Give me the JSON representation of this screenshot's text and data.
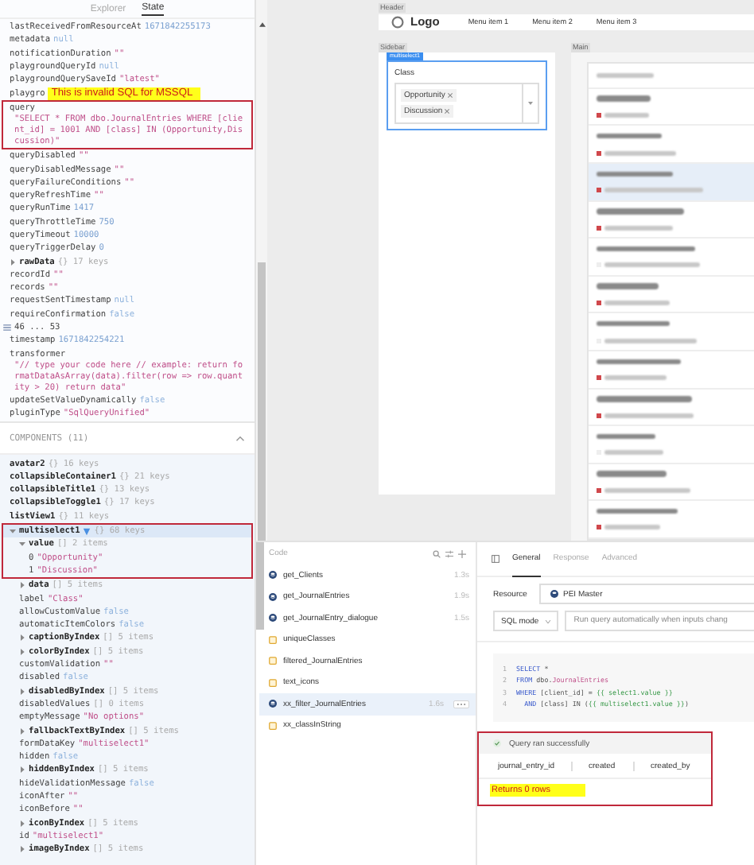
{
  "state_panel": {
    "tabs": [
      {
        "label": "Explorer",
        "selected": false
      },
      {
        "label": "State",
        "selected": true
      }
    ],
    "entries": [
      {
        "key": "lastReceivedFromResourceAt",
        "value": "1671842255173",
        "kind": "number"
      },
      {
        "key": "metadata",
        "value": "null",
        "kind": "literal"
      },
      {
        "key": "notificationDuration",
        "value": "\"\"",
        "kind": "string"
      },
      {
        "key": "playgroundQueryId",
        "value": "null",
        "kind": "literal"
      },
      {
        "key": "playgroundQuerySaveId",
        "value": "\"latest\"",
        "kind": "string"
      },
      {
        "key": "playgro",
        "note": "This is invalid SQL for MSSQL"
      },
      {
        "key": "query",
        "value": "\"SELECT * FROM dbo.JournalEntries WHERE [client_id] = 1001 AND [class] IN (Opportunity,Discussion)\"",
        "kind": "string",
        "block": true,
        "boxed": true
      },
      {
        "key": "queryDisabled",
        "value": "\"\"",
        "kind": "string"
      },
      {
        "key": "queryDisabledMessage",
        "value": "\"\"",
        "kind": "string"
      },
      {
        "key": "queryFailureConditions",
        "value": "\"\"",
        "kind": "string"
      },
      {
        "key": "queryRefreshTime",
        "value": "\"\"",
        "kind": "string"
      },
      {
        "key": "queryRunTime",
        "value": "1417",
        "kind": "number"
      },
      {
        "key": "queryThrottleTime",
        "value": "750",
        "kind": "number"
      },
      {
        "key": "queryTimeout",
        "value": "10000",
        "kind": "number"
      },
      {
        "key": "queryTriggerDelay",
        "value": "0",
        "kind": "number"
      },
      {
        "key": "rawData",
        "value": "{} 17 keys",
        "kind": "summary",
        "bold": true,
        "expanded": false
      },
      {
        "key": "recordId",
        "value": "\"\"",
        "kind": "string"
      },
      {
        "key": "records",
        "value": "\"\"",
        "kind": "string"
      },
      {
        "key": "requestSentTimestamp",
        "value": "null",
        "kind": "literal"
      },
      {
        "key": "requireConfirmation",
        "value": "false",
        "kind": "literal"
      },
      {
        "key": "46 ... 53",
        "range": true
      },
      {
        "key": "timestamp",
        "value": "1671842254221",
        "kind": "number"
      },
      {
        "key": "transformer",
        "value": "\"// type your code here // example: return formatDataAsArray(data).filter(row => row.quantity > 20) return data\"",
        "kind": "string",
        "block": true
      },
      {
        "key": "updateSetValueDynamically",
        "value": "false",
        "kind": "literal"
      },
      {
        "key": "pluginType",
        "value": "\"SqlQueryUnified\"",
        "kind": "string"
      }
    ],
    "components": {
      "title": "COMPONENTS (11)",
      "expanded": true,
      "items": [
        {
          "key": "avatar2",
          "value": "{} 16 keys",
          "kind": "summary",
          "bold": true,
          "selected": false
        },
        {
          "key": "collapsibleContainer1",
          "value": "{} 21 keys",
          "kind": "summary",
          "bold": true,
          "selected": false
        },
        {
          "key": "collapsibleTitle1",
          "value": "{} 13 keys",
          "kind": "summary",
          "bold": true,
          "selected": false
        },
        {
          "key": "collapsibleToggle1",
          "value": "{} 17 keys",
          "kind": "summary",
          "bold": true,
          "selected": false
        },
        {
          "key": "listView1",
          "value": "{} 11 keys",
          "kind": "summary",
          "bold": true,
          "selected": false
        },
        {
          "key": "multiselect1",
          "value": "{} 68 keys",
          "kind": "summary",
          "bold": true,
          "selected": true,
          "boxed": true,
          "expanded": true,
          "children": [
            {
              "key": "value",
              "value": "[] 2 items",
              "kind": "summary",
              "bold": true,
              "boxed": true,
              "expanded": true,
              "children": [
                {
                  "key": "0",
                  "value": "\"Opportunity\"",
                  "kind": "string",
                  "boxed": true
                },
                {
                  "key": "1",
                  "value": "\"Discussion\"",
                  "kind": "string",
                  "boxed": true
                }
              ]
            },
            {
              "key": "data",
              "value": "[] 5 items",
              "kind": "summary",
              "bold": true,
              "expanded": false
            },
            {
              "key": "label",
              "value": "\"Class\"",
              "kind": "string"
            },
            {
              "key": "allowCustomValue",
              "value": "false",
              "kind": "literal"
            },
            {
              "key": "automaticItemColors",
              "value": "false",
              "kind": "literal"
            },
            {
              "key": "captionByIndex",
              "value": "[] 5 items",
              "kind": "summary",
              "bold": true,
              "expanded": false
            },
            {
              "key": "colorByIndex",
              "value": "[] 5 items",
              "kind": "summary",
              "bold": true,
              "expanded": false
            },
            {
              "key": "customValidation",
              "value": "\"\"",
              "kind": "string"
            },
            {
              "key": "disabled",
              "value": "false",
              "kind": "literal"
            },
            {
              "key": "disabledByIndex",
              "value": "[] 5 items",
              "kind": "summary",
              "bold": true,
              "expanded": false
            },
            {
              "key": "disabledValues",
              "value": "[] 0 items",
              "kind": "summary"
            },
            {
              "key": "emptyMessage",
              "value": "\"No options\"",
              "kind": "string"
            },
            {
              "key": "fallbackTextByIndex",
              "value": "[] 5 items",
              "kind": "summary",
              "bold": true,
              "expanded": false
            },
            {
              "key": "formDataKey",
              "value": "\"multiselect1\"",
              "kind": "string"
            },
            {
              "key": "hidden",
              "value": "false",
              "kind": "literal"
            },
            {
              "key": "hiddenByIndex",
              "value": "[] 5 items",
              "kind": "summary",
              "bold": true,
              "expanded": false
            },
            {
              "key": "hideValidationMessage",
              "value": "false",
              "kind": "literal"
            },
            {
              "key": "iconAfter",
              "value": "\"\"",
              "kind": "string"
            },
            {
              "key": "iconBefore",
              "value": "\"\"",
              "kind": "string"
            },
            {
              "key": "iconByIndex",
              "value": "[] 5 items",
              "kind": "summary",
              "bold": true,
              "expanded": false
            },
            {
              "key": "id",
              "value": "\"multiselect1\"",
              "kind": "string"
            },
            {
              "key": "imageByIndex",
              "value": "[] 5 items",
              "kind": "summary",
              "bold": true,
              "expanded": false
            }
          ]
        }
      ]
    }
  },
  "canvas": {
    "header": {
      "label": "Header",
      "logo": "Logo",
      "menu": [
        "Menu item 1",
        "Menu item 2",
        "Menu item 3"
      ]
    },
    "sidebar": {
      "label": "Sidebar",
      "component_tag": "multiselect1",
      "field": {
        "label": "Class",
        "chips": [
          "Opportunity",
          "Discussion"
        ]
      }
    },
    "main": {
      "label": "Main",
      "rows": [
        {
          "selected": false,
          "tagged": true
        },
        {
          "selected": false,
          "tagged": true
        },
        {
          "selected": true,
          "tagged": true
        },
        {
          "selected": false,
          "tagged": true
        },
        {
          "selected": false,
          "tagged": false
        },
        {
          "selected": false,
          "tagged": true
        },
        {
          "selected": false,
          "tagged": false
        },
        {
          "selected": false,
          "tagged": true
        },
        {
          "selected": false,
          "tagged": true
        },
        {
          "selected": false,
          "tagged": false
        },
        {
          "selected": false,
          "tagged": true
        },
        {
          "selected": false,
          "tagged": true
        }
      ]
    }
  },
  "code_panel": {
    "title": "Code",
    "items": [
      {
        "name": "get_Clients",
        "time": "1.3s",
        "kind": "query",
        "selected": false
      },
      {
        "name": "get_JournalEntries",
        "time": "1.9s",
        "kind": "query",
        "selected": false
      },
      {
        "name": "get_JournalEntry_dialogue",
        "time": "1.5s",
        "kind": "query",
        "selected": false
      },
      {
        "name": "uniqueClasses",
        "kind": "transformer",
        "selected": false
      },
      {
        "name": "filtered_JournalEntries",
        "kind": "transformer",
        "selected": false
      },
      {
        "name": "text_icons",
        "kind": "transformer",
        "selected": false
      },
      {
        "name": "xx_filter_JournalEntries",
        "time": "1.6s",
        "kind": "query",
        "selected": true
      },
      {
        "name": "xx_classInString",
        "kind": "transformer",
        "selected": false
      }
    ]
  },
  "query_editor": {
    "tabs": [
      {
        "label": "General",
        "selected": true
      },
      {
        "label": "Response",
        "selected": false
      },
      {
        "label": "Advanced",
        "selected": false
      }
    ],
    "resource_label": "Resource",
    "resource": "PEI Master",
    "mode": "SQL mode",
    "trigger": "Run query automatically when inputs chang",
    "code": [
      {
        "n": "1",
        "tokens": [
          {
            "text": "SELECT",
            "kind": "keyword"
          },
          {
            "text": " *",
            "kind": "plain"
          }
        ]
      },
      {
        "n": "2",
        "tokens": [
          {
            "text": "FROM",
            "kind": "keyword"
          },
          {
            "text": " dbo.",
            "kind": "plain"
          },
          {
            "text": "JournalEntries",
            "kind": "table"
          }
        ]
      },
      {
        "n": "3",
        "tokens": [
          {
            "text": "WHERE",
            "kind": "keyword"
          },
          {
            "text": " [client_id] = ",
            "kind": "plain"
          },
          {
            "text": "{{ select1.value }}",
            "kind": "template"
          }
        ]
      },
      {
        "n": "4",
        "tokens": [
          {
            "text": "  AND",
            "kind": "keyword"
          },
          {
            "text": " [class] IN (",
            "kind": "plain"
          },
          {
            "text": "{{ multiselect1.value }}",
            "kind": "template"
          },
          {
            "text": ")",
            "kind": "plain"
          }
        ]
      }
    ],
    "result": {
      "status": "Query ran successfully",
      "columns": [
        "journal_entry_id",
        "created",
        "created_by"
      ],
      "note": "Returns 0 rows"
    }
  }
}
